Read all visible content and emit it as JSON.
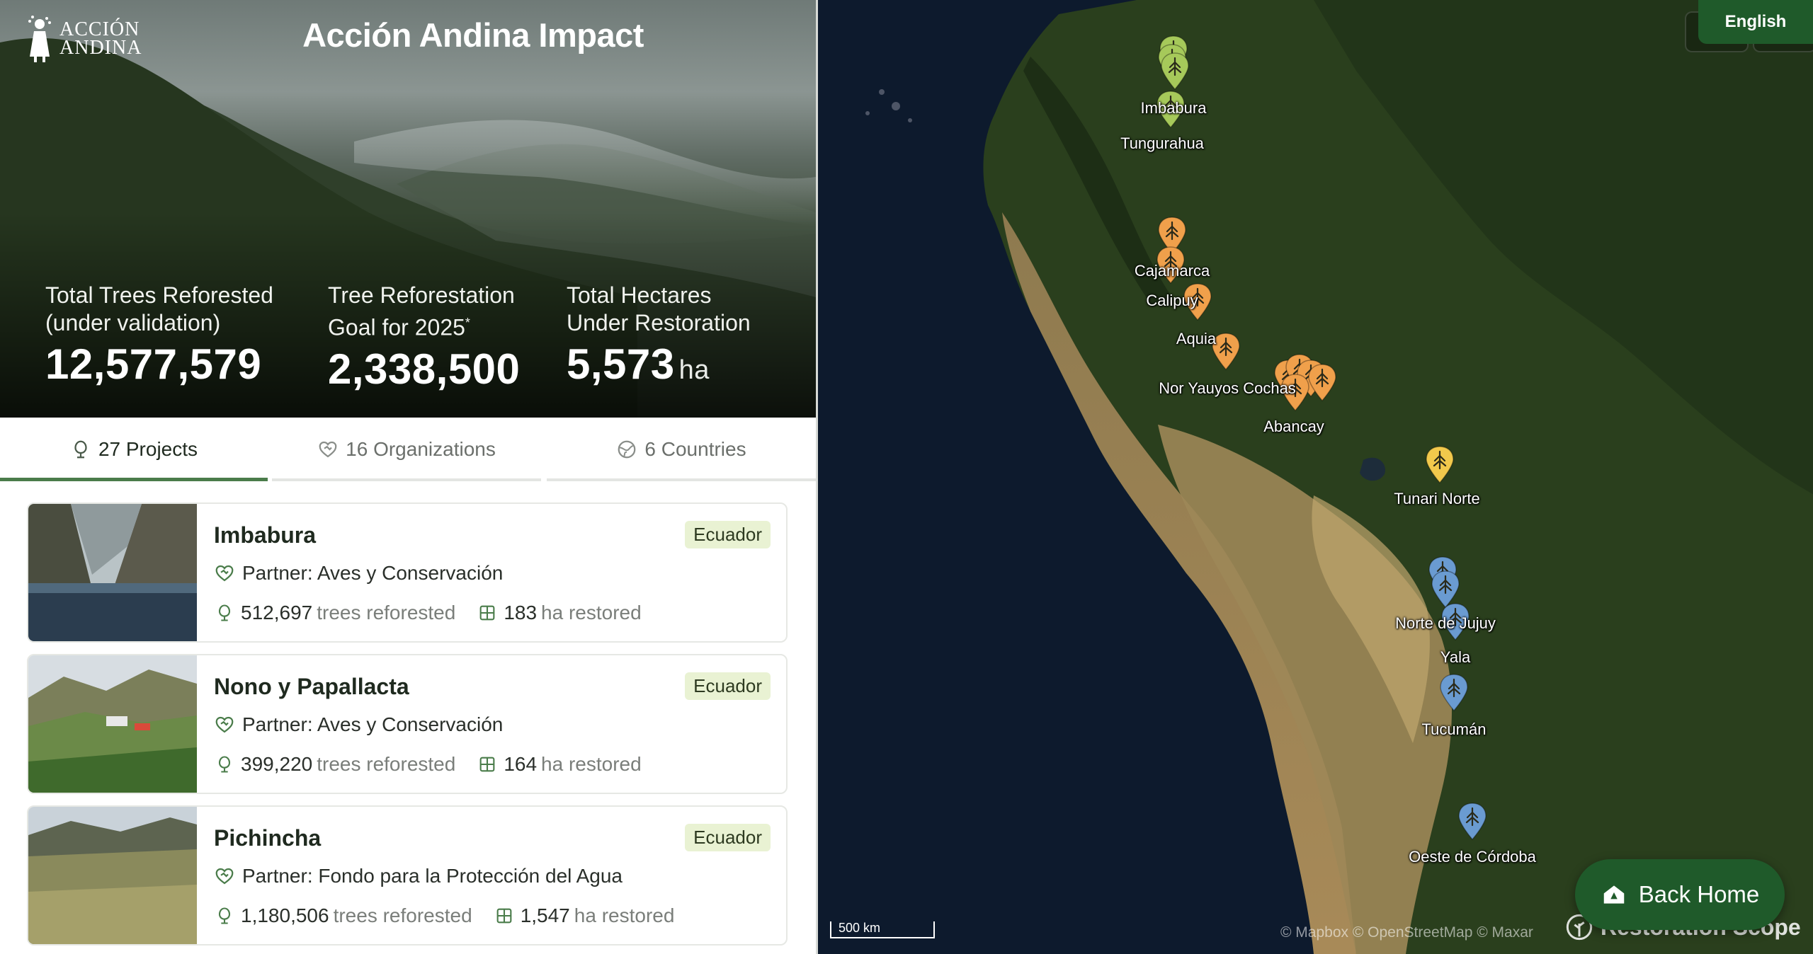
{
  "header": {
    "logo_line1": "ACCIÓN",
    "logo_line2": "ANDINA",
    "title": "Acción Andina Impact"
  },
  "stats": [
    {
      "label_line1": "Total Trees Reforested",
      "label_line2": "(under validation)",
      "value": "12,577,579",
      "unit": ""
    },
    {
      "label_line1": "Tree Reforestation",
      "label_line2": "Goal for 2025",
      "footnote": "*",
      "value": "2,338,500",
      "unit": ""
    },
    {
      "label_line1": "Total Hectares",
      "label_line2": "Under Restoration",
      "value": "5,573",
      "unit": "ha"
    }
  ],
  "tabs": [
    {
      "label": "27 Projects",
      "icon": "tree-icon",
      "active": true
    },
    {
      "label": "16 Organizations",
      "icon": "heart-handshake-icon",
      "active": false
    },
    {
      "label": "6 Countries",
      "icon": "globe-icon",
      "active": false
    }
  ],
  "projects": [
    {
      "name": "Imbabura",
      "country": "Ecuador",
      "partner": "Partner: Aves y Conservación",
      "trees": "512,697",
      "trees_label": "trees reforested",
      "hectares": "183",
      "hectares_label": "ha restored"
    },
    {
      "name": "Nono y Papallacta",
      "country": "Ecuador",
      "partner": "Partner: Aves y Conservación",
      "trees": "399,220",
      "trees_label": "trees reforested",
      "hectares": "164",
      "hectares_label": "ha restored"
    },
    {
      "name": "Pichincha",
      "country": "Ecuador",
      "partner": "Partner: Fondo para la Protección del Agua",
      "trees": "1,180,506",
      "trees_label": "trees reforested",
      "hectares": "1,547",
      "hectares_label": "ha restored"
    }
  ],
  "map": {
    "language": "English",
    "back_home": "Back Home",
    "scale": "500 km",
    "attribution": "© Mapbox © OpenStreetMap © Maxar",
    "brand": "Restoration Scope",
    "colors": {
      "ecuador": "#a6c95a",
      "peru": "#f0a04b",
      "bolivia": "#f2c94c",
      "argentina": "#6a9bd1"
    },
    "labels": [
      "Imbabura",
      "Tungurahua",
      "Cajamarca",
      "Calipuy",
      "Aquia",
      "Nor Yauyos Cochas",
      "Abancay",
      "Tunari Norte",
      "Norte de Jujuy",
      "Yala",
      "Tucumán",
      "Oeste de Córdoba"
    ]
  }
}
